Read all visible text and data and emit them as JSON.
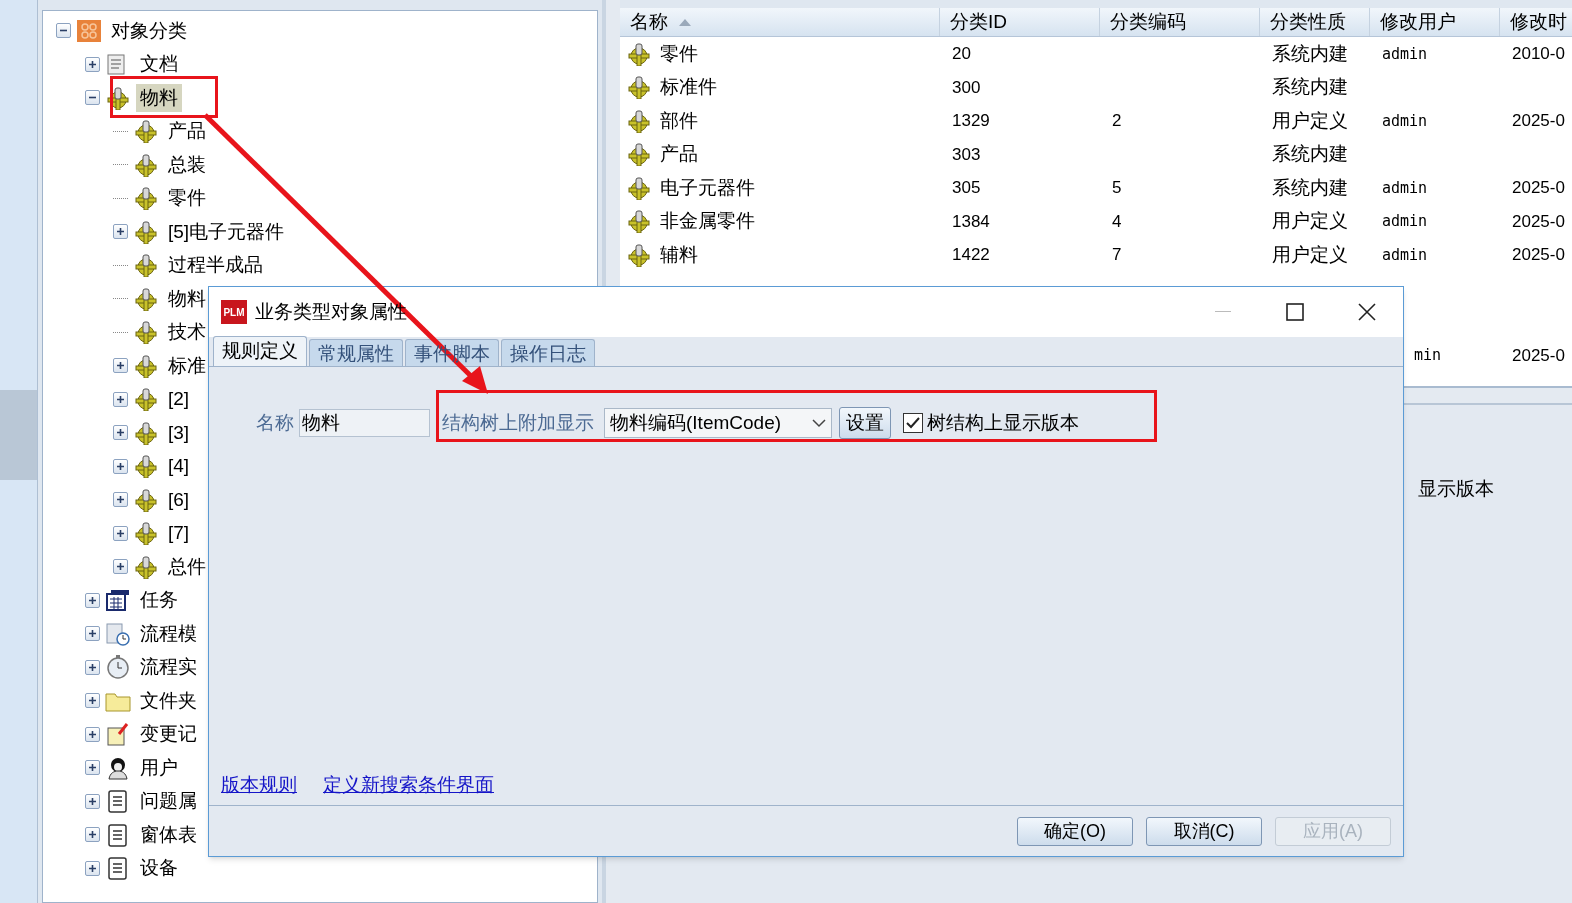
{
  "tree": [
    {
      "label": "对象分类",
      "kind": "category",
      "leaf": false,
      "expanded": true,
      "selected": false,
      "children": [
        {
          "label": "文档",
          "kind": "document",
          "leaf": false,
          "expanded": false,
          "selected": false
        },
        {
          "label": "物料",
          "kind": "gear",
          "leaf": false,
          "expanded": true,
          "selected": true,
          "children": [
            {
              "label": "产品",
              "kind": "gear",
              "leaf": true,
              "expanded": false,
              "selected": false
            },
            {
              "label": "总装",
              "kind": "gear",
              "leaf": true,
              "expanded": false,
              "selected": false
            },
            {
              "label": "零件",
              "kind": "gear",
              "leaf": true,
              "expanded": false,
              "selected": false
            },
            {
              "label": "[5]电子元器件",
              "kind": "gear",
              "leaf": false,
              "expanded": false,
              "selected": false
            },
            {
              "label": "过程半成品",
              "kind": "gear",
              "leaf": true,
              "expanded": false,
              "selected": false
            },
            {
              "label": "物料",
              "kind": "gear",
              "leaf": true,
              "expanded": false,
              "selected": false
            },
            {
              "label": "技术",
              "kind": "gear",
              "leaf": true,
              "expanded": false,
              "selected": false
            },
            {
              "label": "标准",
              "kind": "gear",
              "leaf": false,
              "expanded": false,
              "selected": false
            },
            {
              "label": "[2]",
              "kind": "gear",
              "leaf": false,
              "expanded": false,
              "selected": false
            },
            {
              "label": "[3]",
              "kind": "gear",
              "leaf": false,
              "expanded": false,
              "selected": false
            },
            {
              "label": "[4]",
              "kind": "gear",
              "leaf": false,
              "expanded": false,
              "selected": false
            },
            {
              "label": "[6]",
              "kind": "gear",
              "leaf": false,
              "expanded": false,
              "selected": false
            },
            {
              "label": "[7]",
              "kind": "gear",
              "leaf": false,
              "expanded": false,
              "selected": false
            },
            {
              "label": "总件",
              "kind": "gear",
              "leaf": false,
              "expanded": false,
              "selected": false
            }
          ]
        },
        {
          "label": "任务",
          "kind": "calendar",
          "leaf": false,
          "expanded": false,
          "selected": false
        },
        {
          "label": "流程模",
          "kind": "flow",
          "leaf": false,
          "expanded": false,
          "selected": false
        },
        {
          "label": "流程实",
          "kind": "clock",
          "leaf": false,
          "expanded": false,
          "selected": false
        },
        {
          "label": "文件夹",
          "kind": "folder",
          "leaf": false,
          "expanded": false,
          "selected": false
        },
        {
          "label": "变更记",
          "kind": "note",
          "leaf": false,
          "expanded": false,
          "selected": false
        },
        {
          "label": "用户",
          "kind": "user",
          "leaf": false,
          "expanded": false,
          "selected": false
        },
        {
          "label": "问题属",
          "kind": "list",
          "leaf": false,
          "expanded": false,
          "selected": false
        },
        {
          "label": "窗体表",
          "kind": "list",
          "leaf": false,
          "expanded": false,
          "selected": false
        },
        {
          "label": "设备",
          "kind": "list",
          "leaf": false,
          "expanded": false,
          "selected": false
        }
      ]
    }
  ],
  "table": {
    "columns": [
      {
        "label": "名称",
        "sorted": true
      },
      {
        "label": "分类ID",
        "sorted": false
      },
      {
        "label": "分类编码",
        "sorted": false
      },
      {
        "label": "分类性质",
        "sorted": false
      },
      {
        "label": "修改用户",
        "sorted": false
      },
      {
        "label": "修改时",
        "sorted": false
      }
    ],
    "rows": [
      [
        "零件",
        "20",
        "",
        "系统内建",
        "admin",
        "2010-0"
      ],
      [
        "标准件",
        "300",
        "",
        "系统内建",
        "",
        ""
      ],
      [
        "部件",
        "1329",
        "2",
        "用户定义",
        "admin",
        "2025-0"
      ],
      [
        "产品",
        "303",
        "",
        "系统内建",
        "",
        ""
      ],
      [
        "电子元器件",
        "305",
        "5",
        "系统内建",
        "admin",
        "2025-0"
      ],
      [
        "非金属零件",
        "1384",
        "4",
        "用户定义",
        "admin",
        "2025-0"
      ],
      [
        "辅料",
        "1422",
        "7",
        "用户定义",
        "admin",
        "2025-0"
      ]
    ],
    "partial_row": {
      "user": "min",
      "modified": "2025-0"
    }
  },
  "lower_panel": {
    "text": "显示版本"
  },
  "dialog": {
    "title": "业务类型对象属性",
    "app_badge": "PLM",
    "tabs": [
      {
        "label": "规则定义",
        "selected": true
      },
      {
        "label": "常规属性",
        "selected": false
      },
      {
        "label": "事件脚本",
        "selected": false
      },
      {
        "label": "操作日志",
        "selected": false
      }
    ],
    "name_label": "名称",
    "name_value": "物料",
    "display_label": "结构树上附加显示",
    "display_value": "物料编码(ItemCode)",
    "settings_button": "设置",
    "show_version": {
      "label": "树结构上显示版本",
      "checked": true
    },
    "links": [
      "版本规则",
      "定义新搜索条件界面"
    ],
    "buttons": [
      {
        "label": "确定(O)",
        "disabled": false
      },
      {
        "label": "取消(C)",
        "disabled": false
      },
      {
        "label": "应用(A)",
        "disabled": true
      }
    ]
  }
}
